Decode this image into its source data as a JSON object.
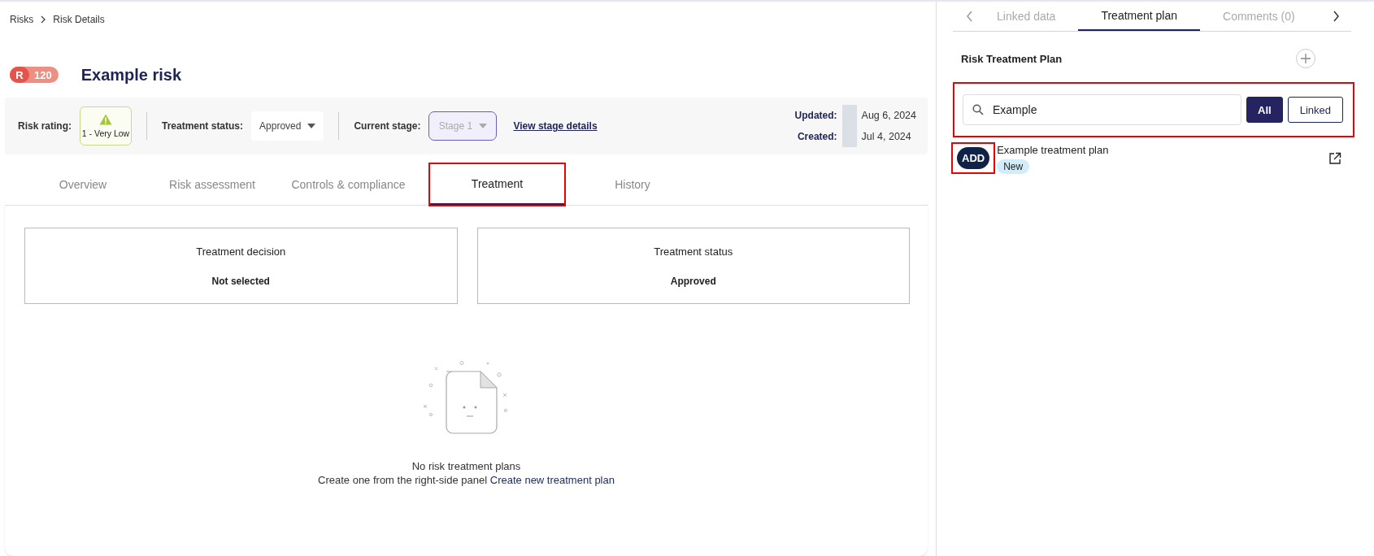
{
  "breadcrumb": [
    "Risks",
    "Risk Details"
  ],
  "risk": {
    "code": "R",
    "score": "120",
    "title": "Example risk"
  },
  "info_bar": {
    "risk_rating_label": "Risk rating:",
    "risk_rating": "1 - Very Low",
    "treatment_status_label": "Treatment status:",
    "treatment_status": "Approved",
    "current_stage_label": "Current stage:",
    "current_stage": "Stage 1",
    "current_stage_disabled": true,
    "stage_link": "View stage details",
    "updated_label": "Updated:",
    "updated": "Aug 6, 2024",
    "created_label": "Created:",
    "created": "Jul 4, 2024"
  },
  "tabs": [
    {
      "label": "Overview",
      "selected": false,
      "highlighted": false
    },
    {
      "label": "Risk assessment",
      "selected": false,
      "highlighted": false
    },
    {
      "label": "Controls & compliance",
      "selected": false,
      "highlighted": false
    },
    {
      "label": "Treatment",
      "selected": true,
      "highlighted": true
    },
    {
      "label": "History",
      "selected": false,
      "highlighted": false
    }
  ],
  "cards": [
    {
      "title": "Treatment decision",
      "value": "Not selected"
    },
    {
      "title": "Treatment status",
      "value": "Approved"
    }
  ],
  "empty_state": {
    "title": "No risk treatment plans",
    "text": "Create one from the right-side panel",
    "link": "Create new treatment plan"
  },
  "side_panel": {
    "tabs": [
      {
        "label": "Linked data",
        "selected": false
      },
      {
        "label": "Treatment plan",
        "selected": true
      },
      {
        "label": "Comments (0)",
        "selected": false
      }
    ],
    "title": "Risk Treatment Plan",
    "search": {
      "value": "Example",
      "highlighted": true
    },
    "filters": [
      {
        "label": "All",
        "selected": true
      },
      {
        "label": "Linked",
        "selected": false
      }
    ],
    "plans": [
      {
        "badge": "ADD",
        "badge_highlighted": true,
        "name": "Example treatment plan",
        "status": "New"
      }
    ]
  }
}
